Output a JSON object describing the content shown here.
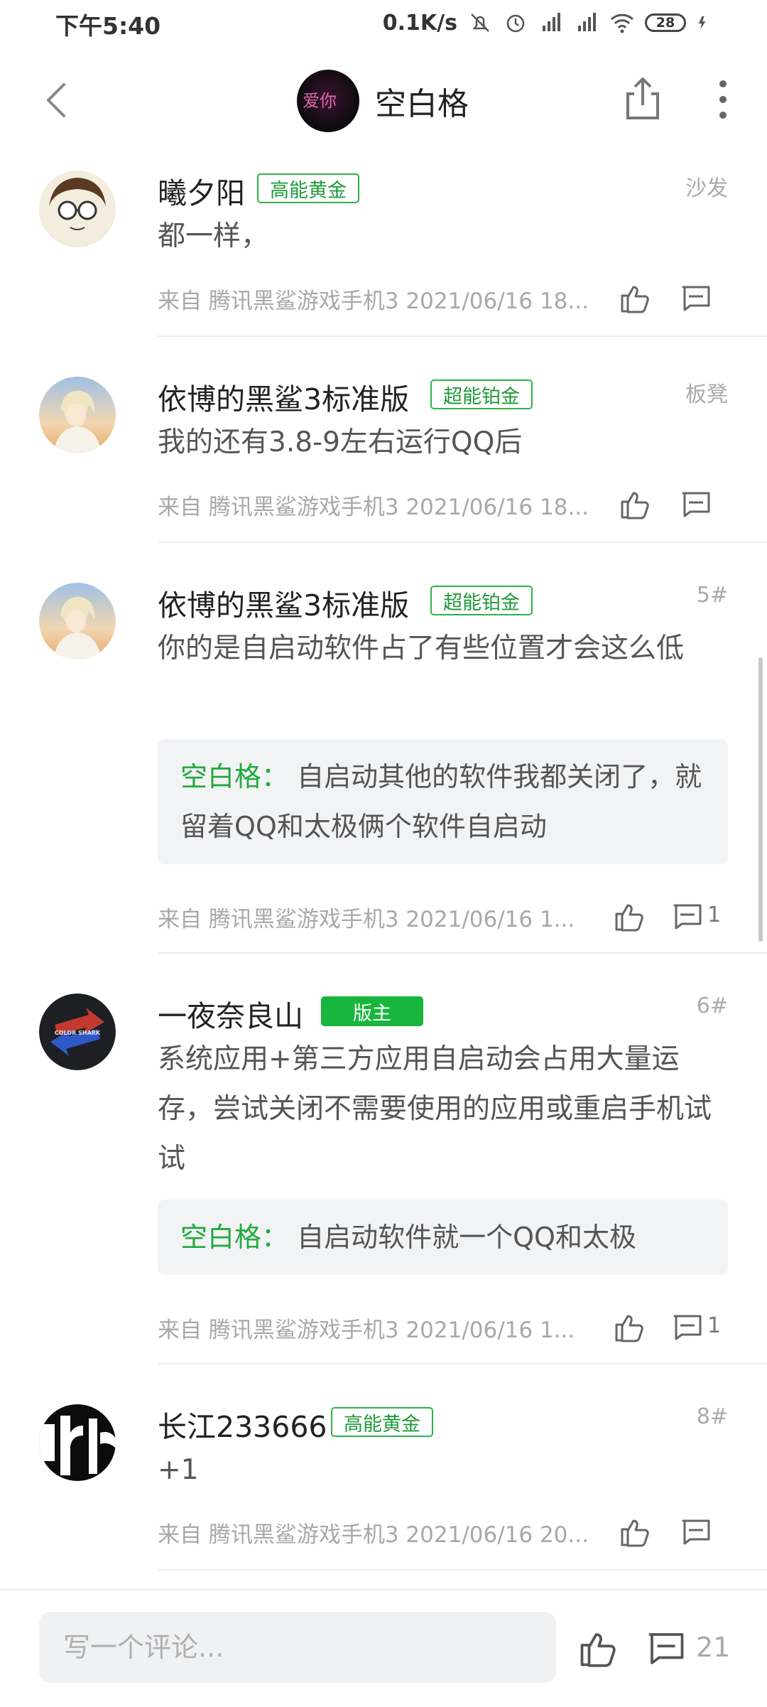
{
  "status_bar": {
    "time": "下午5:40",
    "net_speed": "0.1K/s",
    "battery": "28",
    "icons": [
      "mute-icon",
      "alarm-icon",
      "hd-signal-icon",
      "signal-icon",
      "wifi-icon",
      "battery-icon",
      "charging-icon"
    ]
  },
  "header": {
    "title": "空白格",
    "avatar_text": "爱你"
  },
  "comments": [
    {
      "username": "曦夕阳",
      "badge": "高能黄金",
      "badge_style": "outline",
      "floor": "沙发",
      "content": "都一样，",
      "meta": "来自 腾讯黑鲨游戏手机3   2021/06/16 18...",
      "comment_count": ""
    },
    {
      "username": "依博的黑鲨3标准版",
      "badge": "超能铂金",
      "badge_style": "outline",
      "floor": "板凳",
      "content": "我的还有3.8-9左右运行QQ后",
      "meta": "来自 腾讯黑鲨游戏手机3   2021/06/16 18...",
      "comment_count": ""
    },
    {
      "username": "依博的黑鲨3标准版",
      "badge": "超能铂金",
      "badge_style": "outline",
      "floor": "5#",
      "content": "你的是自启动软件占了有些位置才会这么低",
      "reply": {
        "name": "空白格",
        "sep": "：",
        "text": "自启动其他的软件我都关闭了，就留着QQ和太极俩个软件自启动"
      },
      "meta": "来自 腾讯黑鲨游戏手机3   2021/06/16 1...",
      "comment_count": "1"
    },
    {
      "username": "一夜奈良山",
      "badge": "版主",
      "badge_style": "solid",
      "floor": "6#",
      "content": "系统应用+第三方应用自启动会占用大量运存，尝试关闭不需要使用的应用或重启手机试试",
      "reply": {
        "name": "空白格",
        "sep": "：",
        "text": "自启动软件就一个QQ和太极"
      },
      "meta": "来自 腾讯黑鲨游戏手机3   2021/06/16 1...",
      "comment_count": "1"
    },
    {
      "username": "长江233666",
      "badge": "高能黄金",
      "badge_style": "outline",
      "floor": "8#",
      "content": "+1",
      "meta": "来自 腾讯黑鲨游戏手机3   2021/06/16 20...",
      "comment_count": ""
    }
  ],
  "bottom_bar": {
    "input_placeholder": "写一个评论...",
    "comment_total": "21"
  },
  "colors": {
    "accent_green": "#22aa3d",
    "badge_solid": "#18b63c",
    "meta_gray": "#a8a8a8"
  }
}
